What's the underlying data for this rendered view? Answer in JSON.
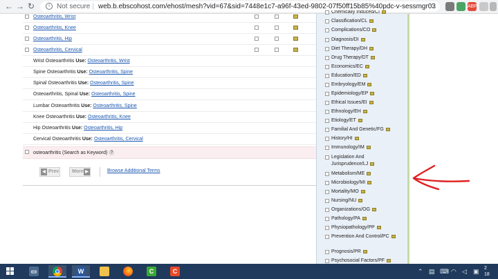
{
  "browser": {
    "omnibox_security": "Not secure",
    "omnibox_url": "web.b.ebscohost.com/ehost/mesh?vid=67&sid=7448e1c7-a96f-43ed-9802-07f50ff15b85%40pdc-v-sessmgr03",
    "ext_badge": "ABP"
  },
  "results": {
    "terms": [
      {
        "label": "Osteoarthritis, Wrist"
      },
      {
        "label": "Osteoarthritis, Knee"
      },
      {
        "label": "Osteoarthritis, Hip"
      },
      {
        "label": "Osteoarthritis, Cervical"
      }
    ],
    "use_word": "Use:",
    "use_rows": [
      {
        "entry": "Wrist Osteoarthritis",
        "target": "Osteoarthritis, Wrist"
      },
      {
        "entry": "Spine Osteoarthritis",
        "target": "Osteoarthritis, Spine"
      },
      {
        "entry": "Spinal Osteoarthritis",
        "target": "Osteoarthritis, Spine"
      },
      {
        "entry": "Osteoarthritis, Spinal",
        "target": "Osteoarthritis, Spine"
      },
      {
        "entry": "Lumbar Osteoarthritis",
        "target": "Osteoarthritis, Spine"
      },
      {
        "entry": "Knee Osteoarthritis",
        "target": "Osteoarthritis, Knee"
      },
      {
        "entry": "Hip Osteoarthritis",
        "target": "Osteoarthritis, Hip"
      },
      {
        "entry": "Cervical Osteoarthritis",
        "target": "Osteoarthritis, Cervical"
      }
    ],
    "keyword_row": "osteoarthritis (Search as Keyword)",
    "help_glyph": "?",
    "prev_label": "Prev",
    "more_label": "More",
    "browse_label": "Browse Additional Terms"
  },
  "subheadings": [
    {
      "label": "Chemically Induced/CI",
      "partial": true
    },
    {
      "label": "Classification/CL"
    },
    {
      "label": "Complications/CO"
    },
    {
      "label": "Diagnosis/DI"
    },
    {
      "label": "Diet Therapy/DH"
    },
    {
      "label": "Drug Therapy/DT"
    },
    {
      "label": "Economics/EC"
    },
    {
      "label": "Education/ED"
    },
    {
      "label": "Embryology/EM"
    },
    {
      "label": "Epidemiology/EP"
    },
    {
      "label": "Ethical Issues/EI"
    },
    {
      "label": "Ethnology/EH"
    },
    {
      "label": "Etiology/ET"
    },
    {
      "label": "Familial And Genetic/FG"
    },
    {
      "label": "History/HI"
    },
    {
      "label": "Immunology/IM"
    },
    {
      "label": "Legislation And"
    },
    {
      "label": "Jurisprudence/LJ"
    },
    {
      "label": "Metabolism/ME"
    },
    {
      "label": "Microbiology/MI"
    },
    {
      "label": "Mortality/MO"
    },
    {
      "label": "Nursing/NU"
    },
    {
      "label": "Organizations/OG"
    },
    {
      "label": "Pathology/PA"
    },
    {
      "label": "Physiopathology/PP"
    },
    {
      "label": "Prevention And Control/PC"
    },
    {
      "label": "Prognosis/PR"
    },
    {
      "label": "Psychosocial Factors/PF"
    }
  ],
  "taskbar": {
    "clock_line1": "2",
    "clock_line2": "18"
  },
  "colors": {
    "annotation_arrow": "#e02020",
    "link": "#1a56b0",
    "panel_border": "#c4dba8"
  },
  "icons": [
    "back-icon",
    "forward-icon",
    "reload-icon",
    "star-icon",
    "windows-icon",
    "chrome-icon",
    "word-icon",
    "explorer-icon",
    "firefox-icon",
    "camtasia-icon"
  ]
}
